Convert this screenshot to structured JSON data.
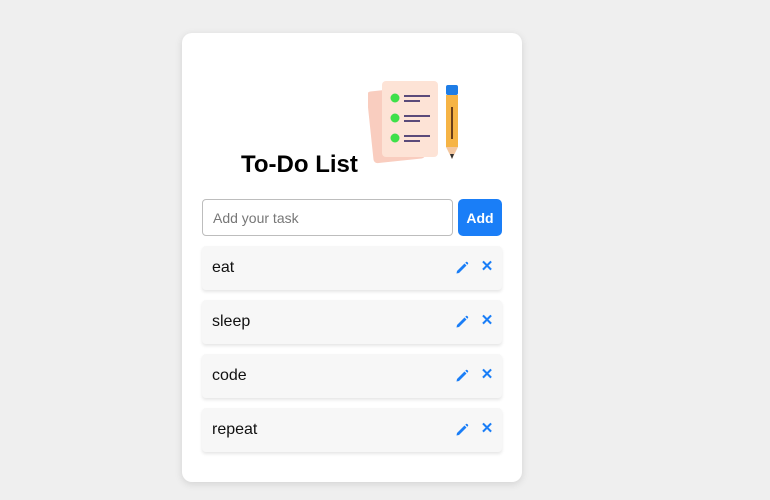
{
  "app": {
    "title": "To-Do List",
    "illustration": "checklist-and-pencil-icon"
  },
  "form": {
    "placeholder": "Add your task",
    "value": "",
    "add_label": "Add"
  },
  "tasks": [
    {
      "text": "eat",
      "edit_icon": "pencil-icon",
      "delete_icon": "close-icon"
    },
    {
      "text": "sleep",
      "edit_icon": "pencil-icon",
      "delete_icon": "close-icon"
    },
    {
      "text": "code",
      "edit_icon": "pencil-icon",
      "delete_icon": "close-icon"
    },
    {
      "text": "repeat",
      "edit_icon": "pencil-icon",
      "delete_icon": "close-icon"
    }
  ],
  "icons": {
    "delete_glyph": "✕"
  },
  "colors": {
    "accent": "#1a7ef7",
    "background": "#efefef",
    "card": "#ffffff",
    "task_background": "#f7f7f7"
  }
}
